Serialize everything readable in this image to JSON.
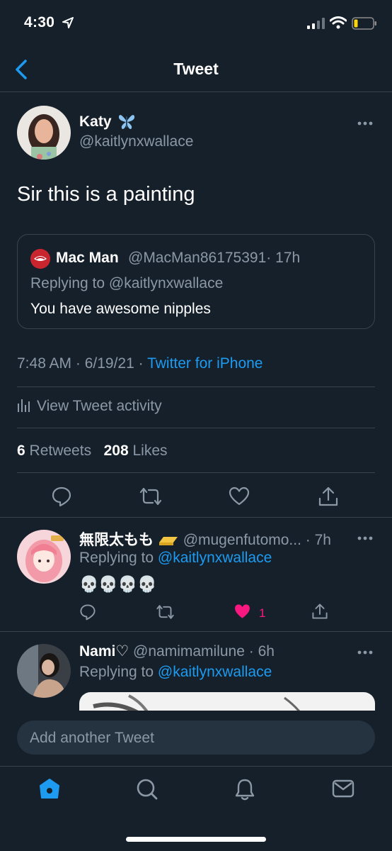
{
  "status_bar": {
    "time": "4:30"
  },
  "nav": {
    "title": "Tweet"
  },
  "tweet": {
    "author_name": "Katy",
    "author_handle": "@kaitlynxwallace",
    "text": "Sir this is a painting",
    "quote": {
      "name": "Mac Man",
      "handle": "@MacMan86175391",
      "time": "· 17h",
      "replying": "Replying to @kaitlynxwallace",
      "text": "You have awesome nipples"
    },
    "time": "7:48 AM · 6/19/21 ·",
    "source": "Twitter for iPhone",
    "activity": "View Tweet activity",
    "retweets": "6",
    "retweets_label": "Retweets",
    "likes": "208",
    "likes_label": "Likes"
  },
  "replies": [
    {
      "name": "無限太もも",
      "handle": "@mugenfutomo...",
      "time": "· 7h",
      "replying_prefix": "Replying to",
      "replying_handle": "@kaitlynxwallace",
      "text": "💀💀💀💀",
      "likes": "1"
    },
    {
      "name": "Nami♡",
      "handle": "@namimamilune",
      "time": "· 6h",
      "replying_prefix": "Replying to",
      "replying_handle": "@kaitlynxwallace"
    }
  ],
  "compose": {
    "placeholder": "Add another Tweet"
  },
  "colors": {
    "background": "#15202b",
    "accent": "#1d9bf0",
    "secondary_text": "#8b98a5",
    "like": "#f91880",
    "divider": "#38444d"
  },
  "icons": [
    "back-chevron-icon",
    "more-icon",
    "reply-icon",
    "retweet-icon",
    "like-icon",
    "share-icon",
    "home-icon",
    "search-icon",
    "notifications-icon",
    "messages-icon"
  ]
}
